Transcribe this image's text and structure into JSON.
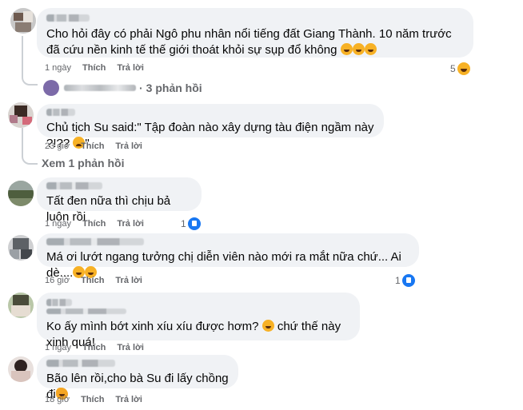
{
  "comments": [
    {
      "text": "Cho hỏi đây có phải Ngô phu nhân nổi tiếng đất Giang Thành. 10 năm trước đã cứu nền kinh tế thế giới thoát khỏi sự sụp đổ không",
      "time": "1 ngày",
      "like_label": "Thích",
      "reply_label": "Trả lời",
      "reaction_count": "5",
      "reaction_icon": "haha-icon"
    },
    {
      "text": "Chủ tịch Su said:\" Tập đoàn nào xây dựng tàu điện ngầm này ?!?? ",
      "text_end": "\"",
      "time": "23 giờ",
      "like_label": "Thích",
      "reply_label": "Trả lời"
    },
    {
      "text": "Tất đen nữa thì chịu bả luôn rồi",
      "time": "1 ngày",
      "like_label": "Thích",
      "reply_label": "Trả lời",
      "reaction_count": "1",
      "reaction_icon": "like-icon"
    },
    {
      "text": "Má ơi lướt ngang tưởng chị diễn viên nào mới ra mắt nữa chứ... Ai dè....",
      "time": "16 giờ",
      "like_label": "Thích",
      "reply_label": "Trả lời",
      "reaction_count": "1",
      "reaction_icon": "like-icon"
    },
    {
      "text": "Ko ấy mình bớt xinh xíu xíu được hơm? ",
      "text_end": " chứ thế này xinh quá!",
      "time": "1 ngày",
      "like_label": "Thích",
      "reply_label": "Trả lời"
    },
    {
      "text": "Bão lên rồi,cho bà Su đi lấy chồng đi",
      "time": "18 giờ",
      "like_label": "Thích",
      "reply_label": "Trả lời"
    }
  ],
  "replies": {
    "first": "3 phản hồi",
    "second": "Xem 1 phản hồi"
  },
  "colors": {
    "bubble": "#f0f2f5",
    "meta": "#65676b",
    "like_blue": "#1877f2",
    "emoji_yellow": "#f7b125"
  }
}
